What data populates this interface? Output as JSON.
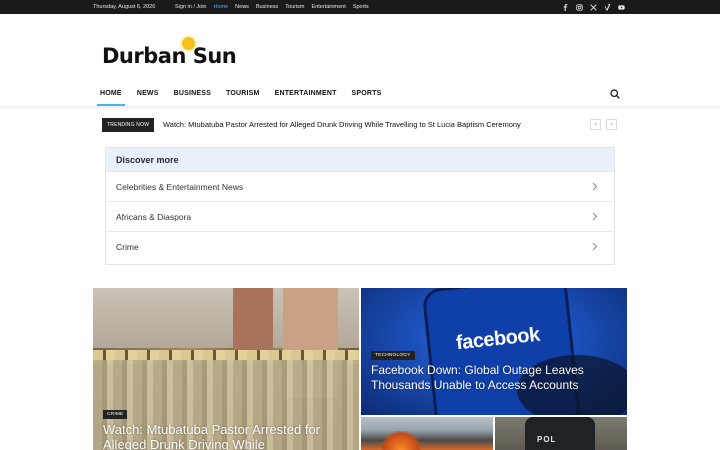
{
  "topbar": {
    "date": "Thursday, August 6, 2026",
    "links": [
      "Sign in / Join",
      "Home",
      "News",
      "Business",
      "Tourism",
      "Entertainment",
      "Sports"
    ],
    "active_link": "Home",
    "social_icons": [
      "facebook-icon",
      "instagram-icon",
      "x-icon",
      "vimeo-icon",
      "youtube-icon"
    ]
  },
  "brand": {
    "name": "Durban Sun",
    "sun_color": "#f6c21a"
  },
  "nav": {
    "items": [
      "HOME",
      "NEWS",
      "BUSINESS",
      "TOURISM",
      "ENTERTAINMENT",
      "SPORTS"
    ],
    "active": "HOME",
    "accent": "#4db2ec"
  },
  "trending": {
    "badge": "TRENDING NOW",
    "headline": "Watch: Mtubatuba Pastor Arrested for Alleged Drunk Driving While Travelling to St Lucia Baptism Ceremony",
    "prev": "‹",
    "next": "›"
  },
  "discover": {
    "title": "Discover more",
    "items": [
      "Celebrities & Entertainment News",
      "Africans & Diaspora",
      "Crime"
    ]
  },
  "featured": {
    "big": {
      "category": "CRIME",
      "title": "Watch: Mtubatuba Pastor Arrested for Alleged Drunk Driving While"
    },
    "fb": {
      "category": "TECHNOLOGY",
      "title": "Facebook Down: Global Outage Leaves Thousands Unable to Access Accounts",
      "image_text": "facebook"
    },
    "small2": {
      "image_text": "POL"
    }
  }
}
